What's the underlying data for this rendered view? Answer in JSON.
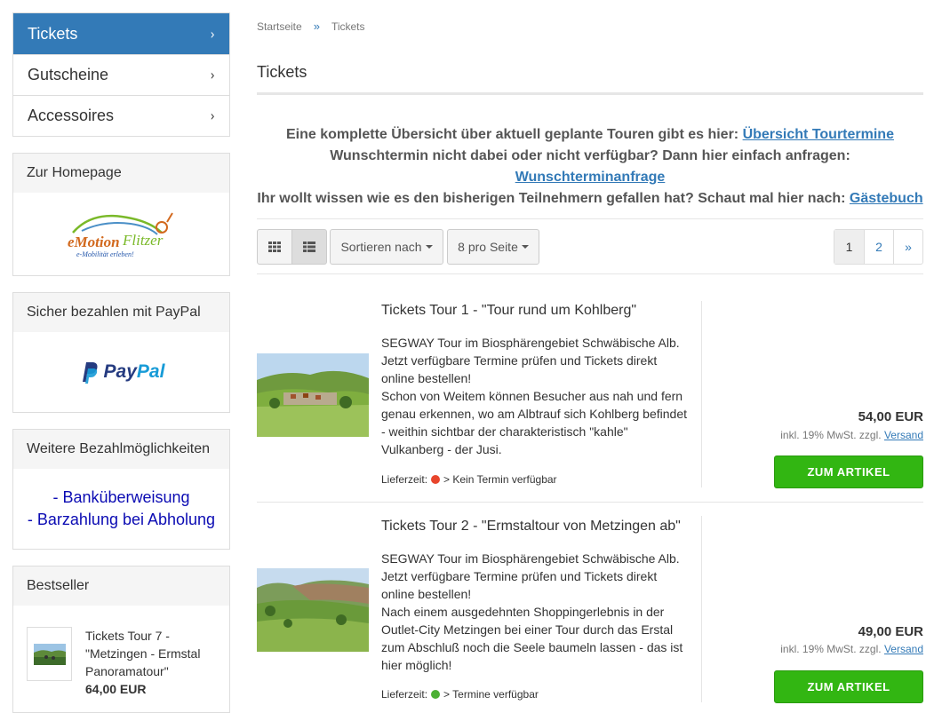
{
  "category_nav": [
    {
      "label": "Tickets",
      "chevron": "›"
    },
    {
      "label": "Gutscheine",
      "chevron": "›"
    },
    {
      "label": "Accessoires",
      "chevron": "›"
    }
  ],
  "homepage_box": {
    "title": "Zur Homepage",
    "logo_text": "eMotion Flitzer",
    "logo_tagline": "e-Mobilität erleben!"
  },
  "paypal_box": {
    "title": "Sicher bezahlen mit PayPal",
    "logo_pay": "Pay",
    "logo_pal": "Pal"
  },
  "payment_box": {
    "title": "Weitere Bezahlmöglichkeiten",
    "items": [
      "- Banküberweisung",
      "- Barzahlung bei Abholung"
    ]
  },
  "bestseller_box": {
    "title": "Bestseller",
    "item": {
      "name_line1": "Tickets Tour 7 -",
      "name_line2": "\"Metzingen - Ermstal",
      "name_line3": "Panoramatour\"",
      "price": "64,00 EUR"
    }
  },
  "breadcrumb": {
    "home": "Startseite",
    "separator": "»",
    "current": "Tickets"
  },
  "page_title": "Tickets",
  "intro": {
    "line1_text": "Eine komplette Übersicht über aktuell geplante Touren gibt es hier: ",
    "line1_link": "Übersicht Tourtermine",
    "line2_text": "Wunschtermin nicht dabei oder nicht verfügbar? Dann hier einfach anfragen: ",
    "line2_link": "Wunschterminanfrage",
    "line3_text": "Ihr wollt wissen wie es den bisherigen Teilnehmern gefallen hat? Schaut mal hier nach: ",
    "line3_link": "Gästebuch"
  },
  "toolbar": {
    "sort_label": "Sortieren nach",
    "per_page_label": "8 pro Seite"
  },
  "pagination": [
    "1",
    "2",
    "»"
  ],
  "products": [
    {
      "title": "Tickets Tour 1 - \"Tour rund um Kohlberg\"",
      "description": "SEGWAY Tour im Biosphärengebiet Schwäbische Alb. Jetzt verfügbare Termine prüfen und Tickets direkt online bestellen!\nSchon von Weitem können Besucher aus nah und fern genau erkennen, wo am Albtrauf sich Kohlberg befindet - weithin sichtbar der charakteristisch \"kahle\" Vulkanberg - der Jusi.",
      "delivery_label": "Lieferzeit:",
      "delivery_status": "> Kein Termin verfügbar",
      "status_color": "#e8452c",
      "price": "54,00 EUR",
      "tax_text": "inkl. 19% MwSt. zzgl.",
      "shipping_link": "Versand",
      "button": "ZUM ARTIKEL"
    },
    {
      "title": "Tickets Tour 2 - \"Ermstaltour von Metzingen ab\"",
      "description": "SEGWAY Tour im Biosphärengebiet Schwäbische Alb. Jetzt verfügbare Termine prüfen und Tickets direkt online bestellen!\nNach einem ausgedehnten Shoppingerlebnis in der Outlet-City Metzingen bei einer Tour durch das Erstal zum Abschluß noch die Seele baumeln lassen - das ist hier möglich!",
      "delivery_label": "Lieferzeit:",
      "delivery_status": "> Termine verfügbar",
      "status_color": "#4cb034",
      "price": "49,00 EUR",
      "tax_text": "inkl. 19% MwSt. zzgl.",
      "shipping_link": "Versand",
      "button": "ZUM ARTIKEL"
    }
  ],
  "colors": {
    "primary": "#337ab7",
    "button_green": "#32b612",
    "payment_link": "#0b0bb3"
  }
}
